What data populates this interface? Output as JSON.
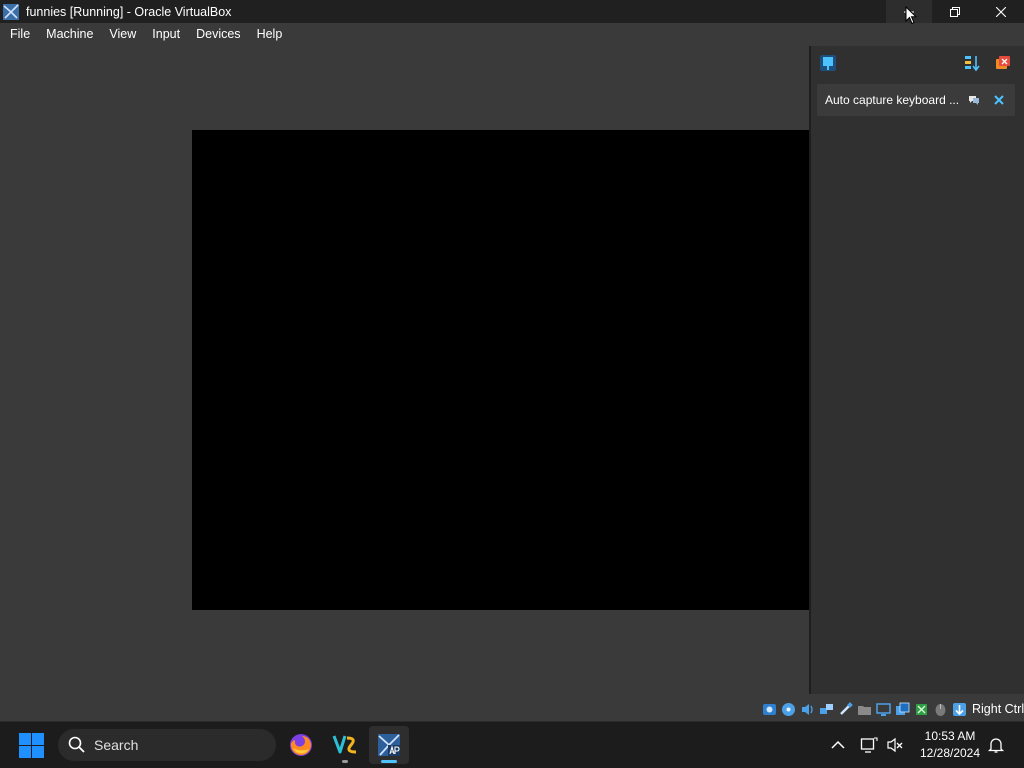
{
  "window": {
    "title": "funnies [Running] - Oracle VirtualBox"
  },
  "menu": {
    "items": [
      "File",
      "Machine",
      "View",
      "Input",
      "Devices",
      "Help"
    ]
  },
  "notifications": {
    "items": [
      {
        "text": "Auto capture keyboard ..."
      }
    ]
  },
  "statusbar": {
    "host_key": "Right Ctrl"
  },
  "taskbar": {
    "search_label": "Search",
    "clock_time": "10:53 AM",
    "clock_date": "12/28/2024"
  },
  "colors": {
    "accent": "#4cc2ff",
    "windows_blue": "#1e90ff",
    "vm_background": "#3a3a3a",
    "taskbar": "#1c1c1c"
  },
  "icons": {
    "start": "windows-logo-icon",
    "search": "search-icon",
    "firefox": "firefox-icon",
    "vscode_like": "code-editor-icon",
    "virtualbox": "virtualbox-icon"
  }
}
